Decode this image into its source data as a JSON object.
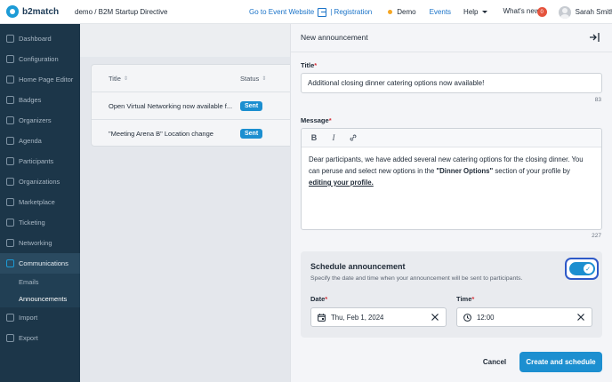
{
  "topbar": {
    "logo": "b2match",
    "event": "demo / B2M Startup Directive",
    "go_to_event": "Go to Event Website",
    "registration": "| Registration",
    "demo": "Demo",
    "events": "Events",
    "help": "Help",
    "whats_new": "What's new",
    "whats_new_count": "0",
    "user_name": "Sarah Smith"
  },
  "sidebar": {
    "items": [
      {
        "label": "Dashboard",
        "icon": "dashboard-icon"
      },
      {
        "label": "Configuration",
        "icon": "configuration-icon"
      },
      {
        "label": "Home Page Editor",
        "icon": "home-page-editor-icon"
      },
      {
        "label": "Badges",
        "icon": "badges-icon"
      },
      {
        "label": "Organizers",
        "icon": "organizers-icon"
      },
      {
        "label": "Agenda",
        "icon": "agenda-icon"
      },
      {
        "label": "Participants",
        "icon": "participants-icon"
      },
      {
        "label": "Organizations",
        "icon": "organizations-icon"
      },
      {
        "label": "Marketplace",
        "icon": "marketplace-icon"
      },
      {
        "label": "Ticketing",
        "icon": "ticketing-icon"
      },
      {
        "label": "Networking",
        "icon": "networking-icon"
      },
      {
        "label": "Communications",
        "icon": "communications-icon"
      }
    ],
    "sub_items": [
      "Emails",
      "Announcements"
    ],
    "bottom_items": [
      {
        "label": "Import",
        "icon": "import-icon"
      },
      {
        "label": "Export",
        "icon": "export-icon"
      }
    ]
  },
  "table": {
    "columns": [
      "Title",
      "Status"
    ],
    "rows": [
      {
        "title": "Open Virtual Networking now available f...",
        "status": "Sent"
      },
      {
        "title": "\"Meeting Arena B\" Location change",
        "status": "Sent"
      }
    ]
  },
  "panel": {
    "heading": "New announcement",
    "title_label": "Title",
    "title_value": "Additional closing dinner catering options now available!",
    "title_count": "83",
    "message_label": "Message",
    "message_part1": "Dear participants, we have added several new catering options for the closing dinner. You can peruse and select new options in the ",
    "message_bold": "\"Dinner Options\"",
    "message_part2": " section of your profile by ",
    "message_link": "editing your profile.",
    "message_count": "227",
    "required_mark": "*"
  },
  "schedule": {
    "title": "Schedule announcement",
    "description": "Specify the date and time when your announcement will be sent to participants.",
    "enabled": true,
    "date_label": "Date",
    "date_value": "Thu, Feb 1, 2024",
    "time_label": "Time",
    "time_value": "12:00"
  },
  "footer": {
    "cancel": "Cancel",
    "create": "Create and schedule"
  },
  "colors": {
    "accent": "#1c8fd0",
    "sidebar": "#1c3649",
    "focus_ring": "#2e59c8",
    "required": "#d6313a"
  }
}
